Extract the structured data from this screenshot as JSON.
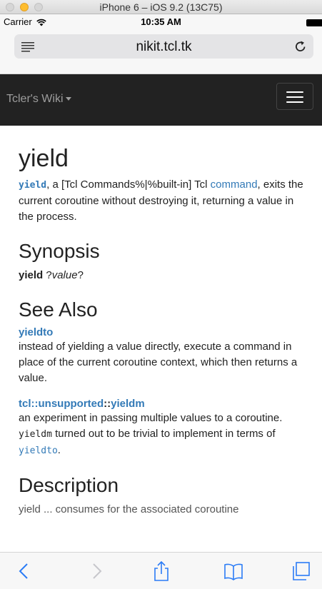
{
  "window": {
    "title": "iPhone 6 – iOS 9.2 (13C75)"
  },
  "status_bar": {
    "carrier": "Carrier",
    "time": "10:35 AM"
  },
  "url_bar": {
    "url": "nikit.tcl.tk"
  },
  "navbar": {
    "brand": "Tcler's Wiki"
  },
  "page": {
    "title": "yield",
    "intro": {
      "cmd": "yield",
      "text1": ", a [Tcl Commands%|%built-in] Tcl ",
      "link": "command",
      "text2": ", exits the current coroutine without destroying it, returning a value in the process."
    },
    "synopsis": {
      "heading": "Synopsis",
      "cmd": "yield",
      "pre": " ?",
      "arg": "value",
      "post": "?"
    },
    "see_also": {
      "heading": "See Also",
      "entries": [
        {
          "title": "yieldto",
          "desc": "instead of yielding a value directly, execute a command in place of the current coroutine context, which then returns a value."
        },
        {
          "title_part1": "tcl::unsupported",
          "title_sep": "::",
          "title_part2": "yieldm",
          "desc1": "an experiment in passing multiple values to a coroutine. ",
          "code": "yieldm",
          "desc2": " turned out to be trivial to implement in terms of ",
          "code_link": "yieldto",
          "desc3": "."
        }
      ]
    },
    "description": {
      "heading": "Description",
      "text": "yield ... consumes for the associated coroutine"
    }
  },
  "toolbar": {
    "icons": [
      "back-icon",
      "forward-icon",
      "share-icon",
      "bookmarks-icon",
      "tabs-icon"
    ]
  },
  "colors": {
    "link": "#337ab7",
    "navbar": "#222222",
    "traffic_min": "#ffbd2e"
  }
}
